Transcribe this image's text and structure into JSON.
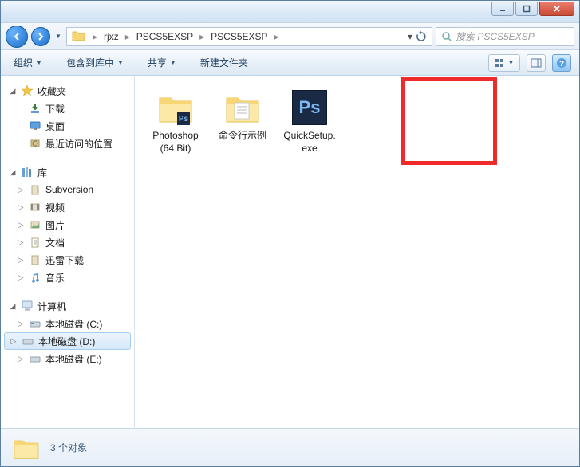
{
  "breadcrumb": {
    "items": [
      "rjxz",
      "PSCS5EXSP",
      "PSCS5EXSP"
    ]
  },
  "search": {
    "placeholder": "搜索 PSCS5EXSP"
  },
  "toolbar": {
    "organize": "组织",
    "include": "包含到库中",
    "share": "共享",
    "newfolder": "新建文件夹"
  },
  "sidebar": {
    "favorites": {
      "label": "收藏夹",
      "items": [
        "下载",
        "桌面",
        "最近访问的位置"
      ]
    },
    "libraries": {
      "label": "库",
      "items": [
        "Subversion",
        "视频",
        "图片",
        "文档",
        "迅雷下载",
        "音乐"
      ]
    },
    "computer": {
      "label": "计算机",
      "items": [
        "本地磁盘 (C:)",
        "本地磁盘 (D:)",
        "本地磁盘 (E:)"
      ],
      "selected_index": 1
    }
  },
  "files": [
    {
      "name": "Photoshop (64 Bit)",
      "type": "folder-ps"
    },
    {
      "name": "命令行示例",
      "type": "folder"
    },
    {
      "name": "QuickSetup.exe",
      "type": "ps-exe"
    }
  ],
  "status": {
    "text": "3 个对象"
  }
}
